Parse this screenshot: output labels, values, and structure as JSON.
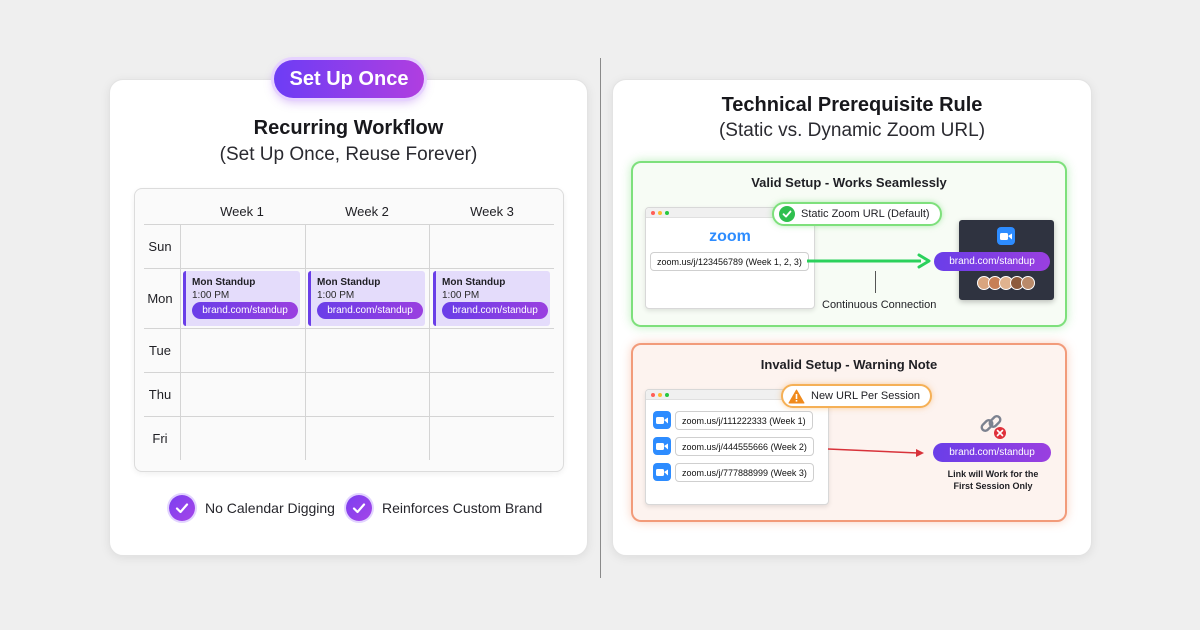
{
  "left": {
    "badge": "Set Up Once",
    "title": "Recurring Workflow",
    "subtitle": "(Set Up Once, Reuse Forever)",
    "calendar": {
      "weeks": [
        "Week 1",
        "Week 2",
        "Week 3"
      ],
      "days": [
        "Sun",
        "Mon",
        "Tue",
        "Thu",
        "Fri"
      ],
      "events": [
        {
          "title": "Mon Standup",
          "time": "1:00 PM",
          "link": "brand.com/standup"
        },
        {
          "title": "Mon Standup",
          "time": "1:00 PM",
          "link": "brand.com/standup"
        },
        {
          "title": "Mon Standup",
          "time": "1:00 PM",
          "link": "brand.com/standup"
        }
      ]
    },
    "features": [
      "No Calendar Digging",
      "Reinforces Custom Brand"
    ]
  },
  "right": {
    "title": "Technical Prerequisite Rule",
    "subtitle": "(Static vs. Dynamic Zoom URL)",
    "valid": {
      "title": "Valid Setup - Works Seamlessly",
      "status": "Static Zoom URL (Default)",
      "logo": "zoom",
      "url": "zoom.us/j/123456789 (Week 1, 2, 3)",
      "caption": "Continuous Connection",
      "brand_link": "brand.com/standup"
    },
    "invalid": {
      "title": "Invalid Setup - Warning Note",
      "status": "New URL Per Session",
      "urls": [
        "zoom.us/j/111222333 (Week 1)",
        "zoom.us/j/444555666 (Week 2)",
        "zoom.us/j/777888999 (Week 3)"
      ],
      "brand_link": "brand.com/standup",
      "note_line1": "Link will Work for the",
      "note_line2": "First Session Only"
    }
  },
  "colors": {
    "accent_purple": "#6a3ee8",
    "valid_green": "#7ee07c",
    "warning_orange": "#f29b7a",
    "zoom_blue": "#2d8cff"
  },
  "icons": [
    "check-icon",
    "warning-icon",
    "zoom-video-icon",
    "broken-link-icon",
    "avatar-group"
  ]
}
